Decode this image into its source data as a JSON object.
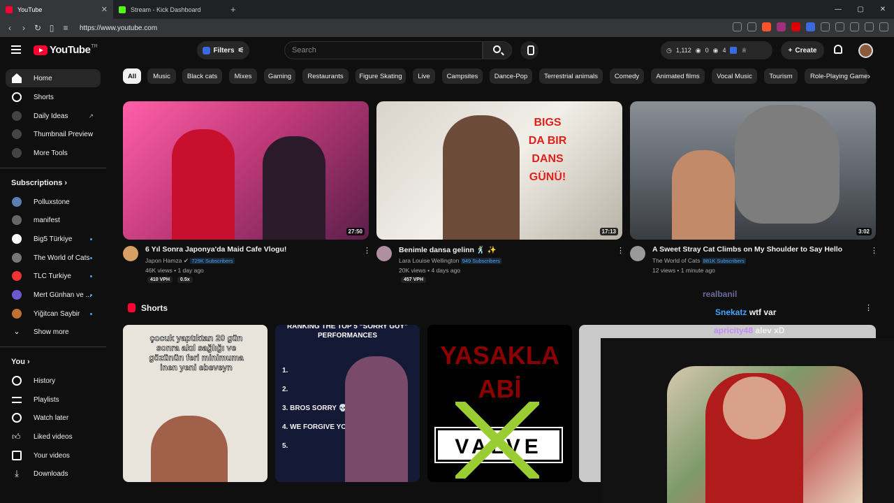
{
  "browser": {
    "tabs": [
      {
        "label": "YouTube",
        "active": true
      },
      {
        "label": "Stream - Kick Dashboard",
        "active": false
      }
    ],
    "url": "https://www.youtube.com"
  },
  "header": {
    "logo_text": "YouTube",
    "country_code": "TR",
    "filters_label": "Filters",
    "search_placeholder": "Search",
    "stats": {
      "views": "1,112",
      "a": "0",
      "b": "4"
    },
    "create_label": "Create"
  },
  "sidebar": {
    "top": [
      {
        "label": "Home",
        "active": true
      },
      {
        "label": "Shorts"
      },
      {
        "label": "Daily Ideas"
      },
      {
        "label": "Thumbnail Preview"
      },
      {
        "label": "More Tools"
      }
    ],
    "subscriptions_title": "Subscriptions",
    "subscriptions": [
      {
        "label": "Polluxstone",
        "dot": false
      },
      {
        "label": "manifest",
        "dot": false
      },
      {
        "label": "Big5 Türkiye",
        "dot": true
      },
      {
        "label": "The World of Cats",
        "dot": true
      },
      {
        "label": "TLC Turkiye",
        "dot": true
      },
      {
        "label": "Mert Günhan ve ...",
        "dot": true
      },
      {
        "label": "Yiğitcan Saybir",
        "dot": true
      }
    ],
    "show_more": "Show more",
    "you_title": "You",
    "you": [
      {
        "label": "History"
      },
      {
        "label": "Playlists"
      },
      {
        "label": "Watch later"
      },
      {
        "label": "Liked videos"
      },
      {
        "label": "Your videos"
      },
      {
        "label": "Downloads"
      }
    ]
  },
  "chips": [
    "All",
    "Music",
    "Black cats",
    "Mixes",
    "Gaming",
    "Restaurants",
    "Figure Skating",
    "Live",
    "Campsites",
    "Dance-Pop",
    "Terrestrial animals",
    "Comedy",
    "Animated films",
    "Vocal Music",
    "Tourism",
    "Role-Playing Games"
  ],
  "videos": [
    {
      "title": "6 Yıl Sonra Japonya'da Maid Cafe Vlogu!",
      "channel": "Japon Hamza",
      "subs": "729K Subscribers",
      "meta": "46K views • 1 day ago",
      "duration": "27:50",
      "badge1": "410 VPH",
      "badge2": "0.5x"
    },
    {
      "title": "Benimle dansa gelinn 🕺 ✨",
      "channel": "Lara Louise Wellington",
      "subs": "949 Subscribers",
      "meta": "20K views • 4 days ago",
      "duration": "17:13",
      "badge1": "457 VPH",
      "badge2": ""
    },
    {
      "title": "A Sweet Stray Cat Climbs on My Shoulder to Say Hello",
      "channel": "The World of Cats",
      "subs": "881K Subscribers",
      "meta": "12 views • 1 minute ago",
      "duration": "3:02",
      "badge1": "",
      "badge2": ""
    }
  ],
  "shorts": {
    "title": "Shorts",
    "items": [
      {
        "caption": "çocuk yaptıktan 20 gün sonra akıl sağlığı ve gözünün feri minimuma inen yeni ebeveyn"
      },
      {
        "caption": "RANKING THE TOP 5 “SORRY GUY” PERFORMANCES",
        "list": [
          "1.",
          "2.",
          "3. BROS SORRY 💀",
          "4. WE FORGIVE YOU",
          "5."
        ]
      },
      {
        "caption": "YASAKLA ABİ",
        "brand": "VALVE"
      },
      {
        "caption": ""
      }
    ]
  },
  "overlay": {
    "chat": [
      {
        "user": "realbanil",
        "msg": ""
      },
      {
        "user": "Snekatz",
        "msg": "wtf var"
      },
      {
        "user": "apricity48",
        "msg": "alev xD"
      }
    ]
  }
}
